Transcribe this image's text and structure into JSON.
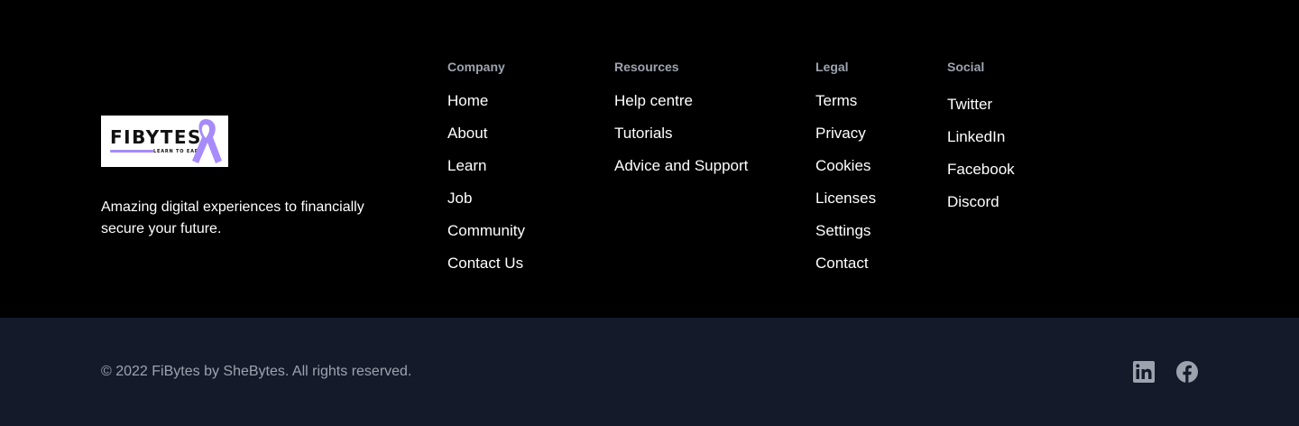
{
  "brand": {
    "logo_text": "FIBYTES",
    "logo_tagline": "LEARN TO EARN",
    "description": "Amazing digital experiences to financially secure your future."
  },
  "columns": {
    "company": {
      "heading": "Company",
      "links": [
        "Home",
        "About",
        "Learn",
        "Job",
        "Community",
        "Contact Us"
      ]
    },
    "resources": {
      "heading": "Resources",
      "links": [
        "Help centre",
        "Tutorials",
        "Advice and Support"
      ]
    },
    "legal": {
      "heading": "Legal",
      "links": [
        "Terms",
        "Privacy",
        "Cookies",
        "Licenses",
        "Settings",
        "Contact"
      ]
    },
    "social": {
      "heading": "Social",
      "links": [
        "Twitter",
        "LinkedIn",
        "Facebook",
        "Discord"
      ]
    }
  },
  "bottom_bar": {
    "copyright": "© 2022 FiBytes by SheBytes. All rights reserved.",
    "icons": [
      "linkedin-icon",
      "facebook-icon"
    ]
  },
  "colors": {
    "top_background": "#000000",
    "bottom_background": "#151a2b",
    "heading_text": "#9ca3af",
    "link_text": "#ffffff",
    "brand_accent": "#a78bfa"
  }
}
